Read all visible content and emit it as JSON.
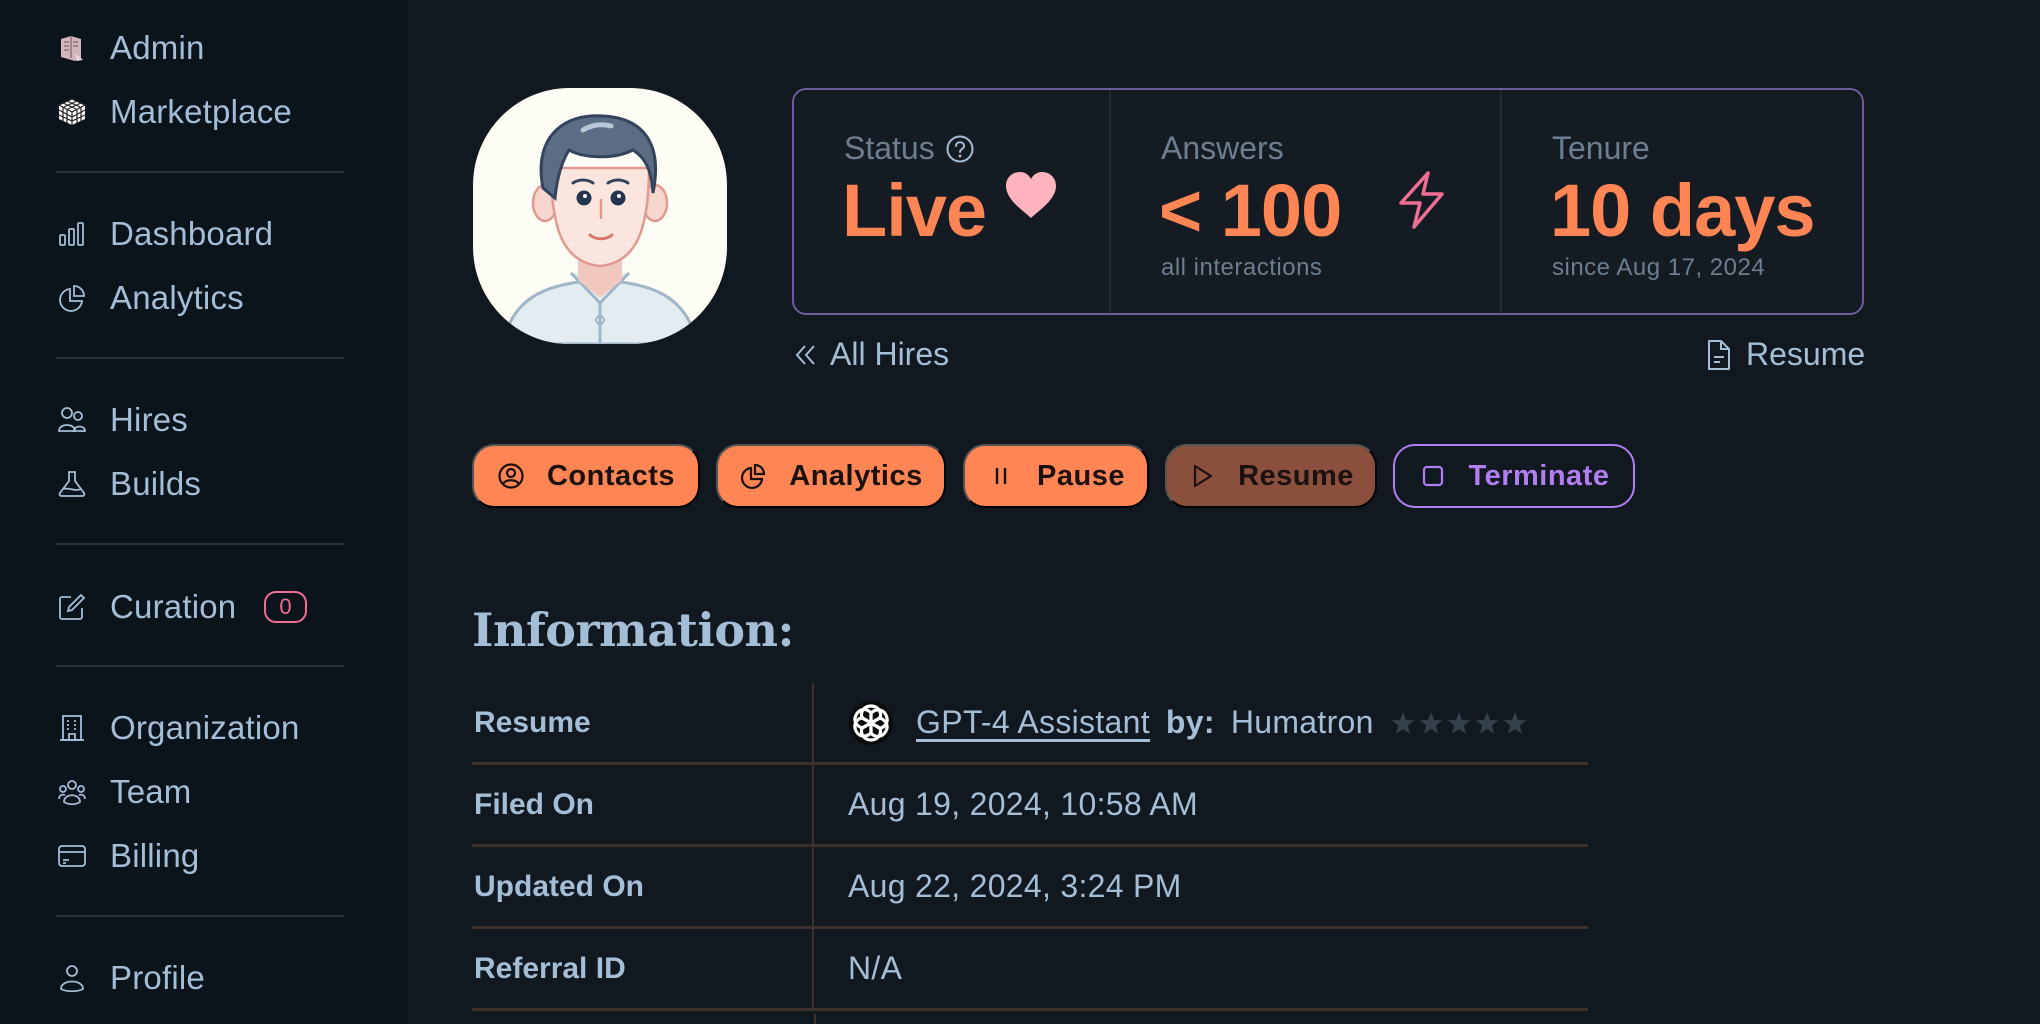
{
  "sidebar": {
    "items": [
      {
        "label": "Admin",
        "icon": "admin-building-icon"
      },
      {
        "label": "Marketplace",
        "icon": "cube-grid-icon"
      },
      {
        "label": "Dashboard",
        "icon": "bar-chart-icon"
      },
      {
        "label": "Analytics",
        "icon": "pie-chart-icon"
      },
      {
        "label": "Hires",
        "icon": "users-icon"
      },
      {
        "label": "Builds",
        "icon": "flask-icon"
      },
      {
        "label": "Curation",
        "icon": "edit-icon",
        "badge": "0"
      },
      {
        "label": "Organization",
        "icon": "office-building-icon"
      },
      {
        "label": "Team",
        "icon": "team-icon"
      },
      {
        "label": "Billing",
        "icon": "credit-card-icon"
      },
      {
        "label": "Profile",
        "icon": "user-icon"
      }
    ]
  },
  "stats": {
    "status": {
      "label": "Status",
      "value": "Live"
    },
    "answers": {
      "label": "Answers",
      "value": "< 100",
      "sub": "all interactions"
    },
    "tenure": {
      "label": "Tenure",
      "value": "10 days",
      "sub": "since Aug 17, 2024"
    }
  },
  "links": {
    "all_hires": "All Hires",
    "resume": "Resume"
  },
  "actions": {
    "contacts": "Contacts",
    "analytics": "Analytics",
    "pause": "Pause",
    "resume": "Resume",
    "terminate": "Terminate"
  },
  "info": {
    "title": "Information:",
    "rows": [
      {
        "key": "Resume",
        "model": "GPT-4 Assistant",
        "by_label": "by:",
        "author": "Humatron",
        "rating": 0,
        "rating_max": 5
      },
      {
        "key": "Filed On",
        "value": "Aug 19, 2024, 10:58 AM"
      },
      {
        "key": "Updated On",
        "value": "Aug 22, 2024, 3:24 PM"
      },
      {
        "key": "Referral ID",
        "value": "N/A"
      }
    ]
  },
  "colors": {
    "accent": "#ff8554",
    "accent_muted": "#8a4f3d",
    "purple": "#b07ef0",
    "pink": "#f06e93",
    "text": "#a3bed6"
  }
}
